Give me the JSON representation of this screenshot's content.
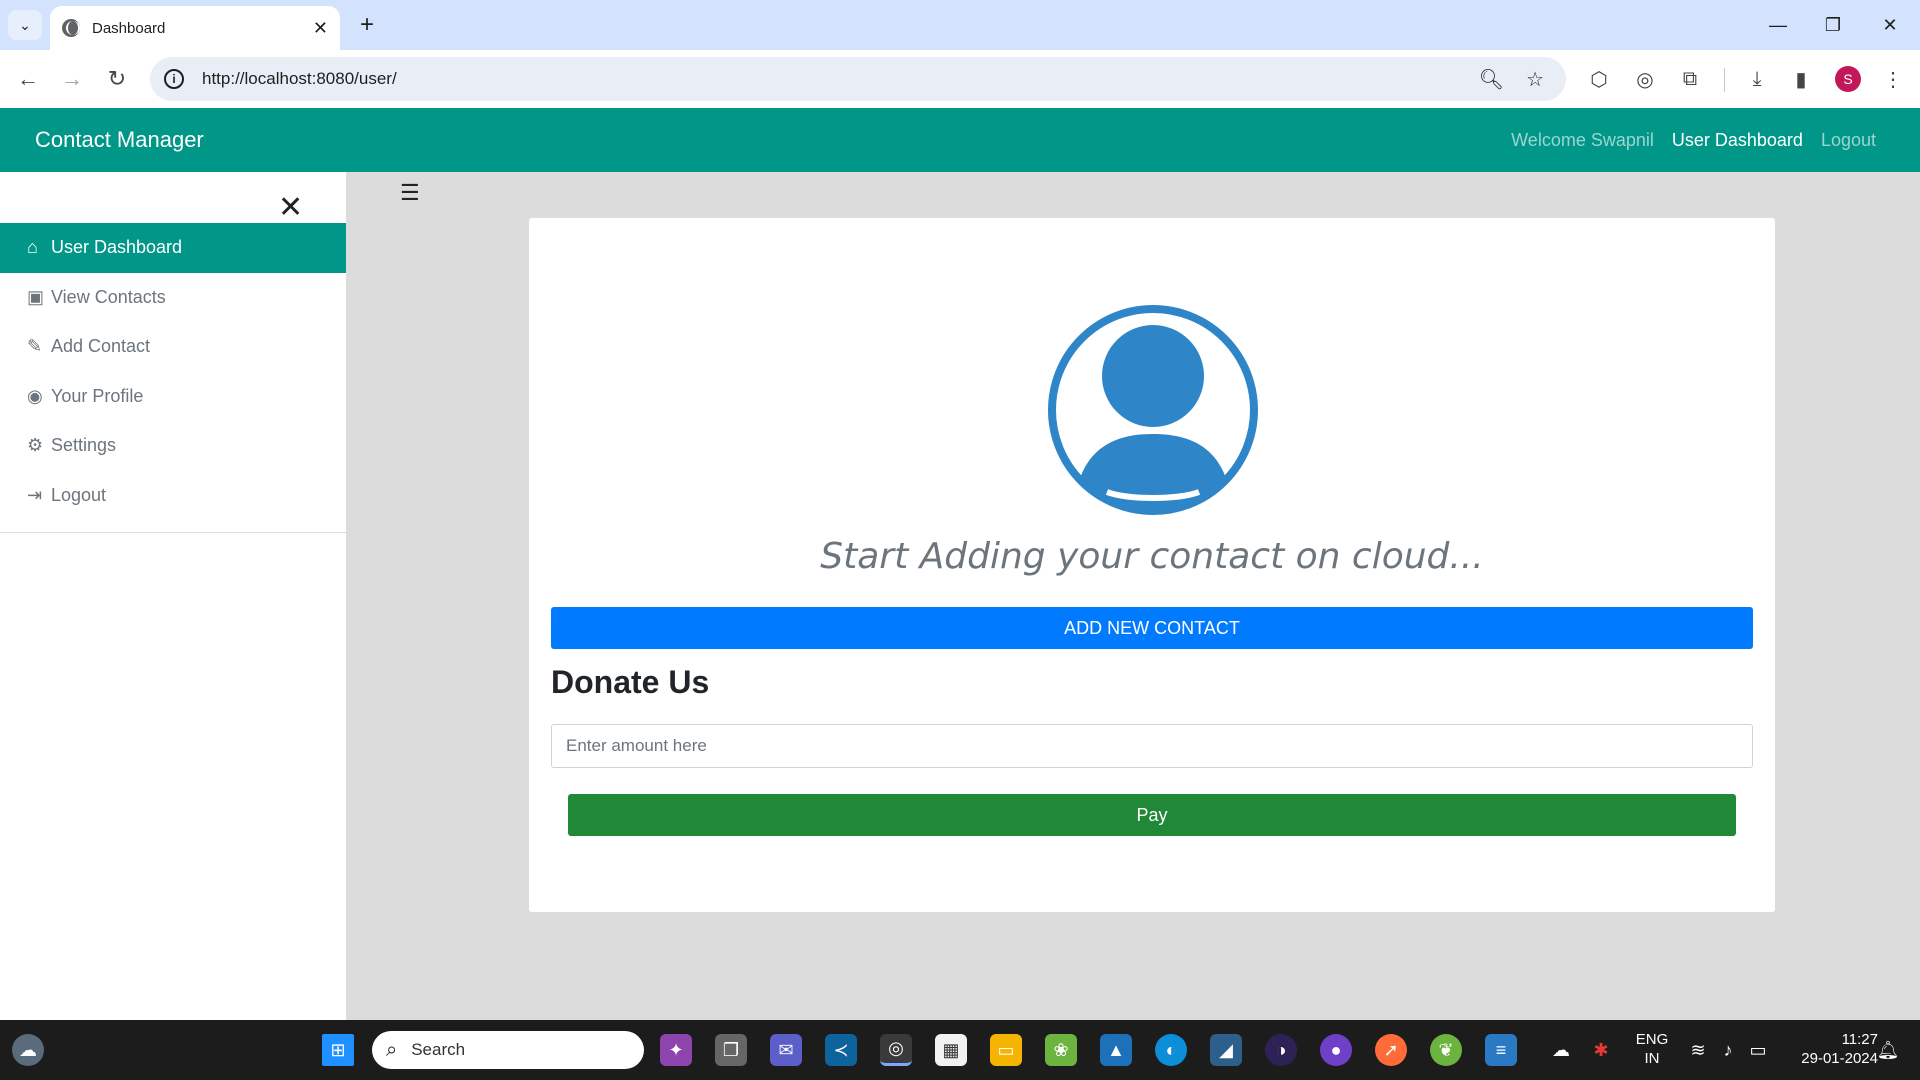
{
  "browser": {
    "tab_title": "Dashboard",
    "url": "http://localhost:8080/user/",
    "profile_initial": "S"
  },
  "app": {
    "brand": "Contact Manager",
    "nav": {
      "welcome": "Welcome Swapnil",
      "dashboard": "User Dashboard",
      "logout": "Logout"
    }
  },
  "sidebar": {
    "items": [
      {
        "label": "User Dashboard",
        "icon": "home-icon"
      },
      {
        "label": "View Contacts",
        "icon": "id-badge-icon"
      },
      {
        "label": "Add Contact",
        "icon": "pencil-icon"
      },
      {
        "label": "Your Profile",
        "icon": "user-circle-icon"
      },
      {
        "label": "Settings",
        "icon": "cogs-icon"
      },
      {
        "label": "Logout",
        "icon": "sign-out-icon"
      }
    ]
  },
  "main": {
    "tagline": "Start Adding your contact on cloud...",
    "add_button": "ADD NEW CONTACT",
    "donate_title": "Donate Us",
    "amount_placeholder": "Enter amount here",
    "pay_button": "Pay"
  },
  "taskbar": {
    "search": "Search",
    "lang_top": "ENG",
    "lang_bottom": "IN",
    "time": "11:27",
    "date": "29-01-2024"
  },
  "colors": {
    "primary_teal": "#009688",
    "button_blue": "#007bff",
    "button_green": "#218838",
    "avatar_blue": "#2e86c9"
  }
}
